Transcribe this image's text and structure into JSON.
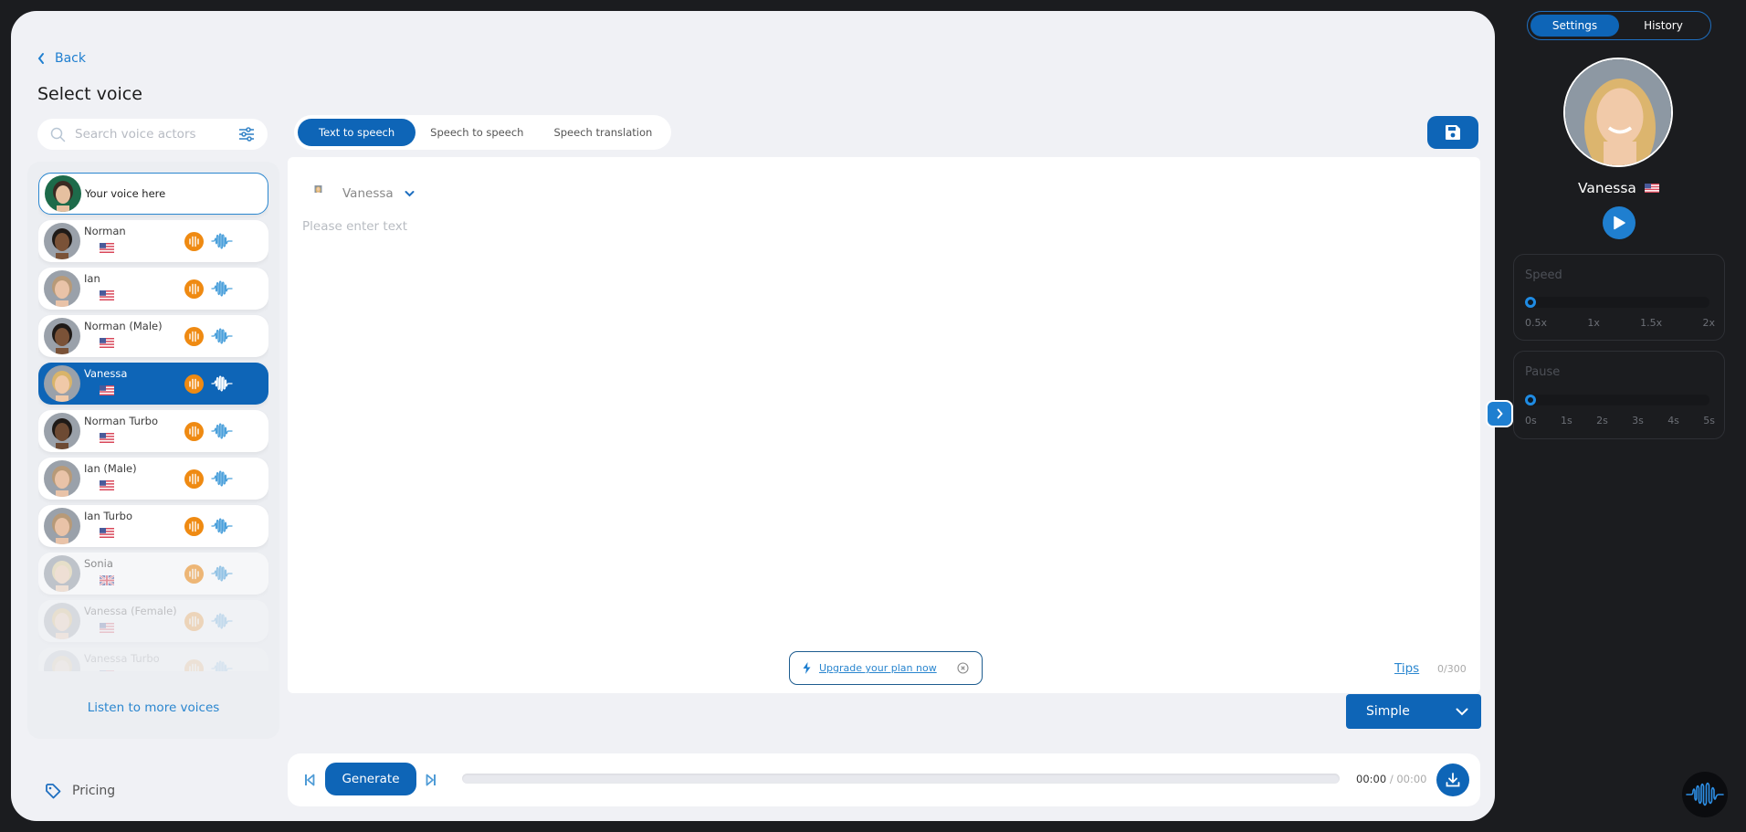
{
  "header": {
    "back_label": "Back",
    "title": "Select voice"
  },
  "search": {
    "placeholder": "Search voice actors",
    "value": ""
  },
  "voices": [
    {
      "name": "Your voice here",
      "flag": "",
      "own": true
    },
    {
      "name": "Norman",
      "flag": "us"
    },
    {
      "name": "Ian",
      "flag": "us"
    },
    {
      "name": "Norman (Male)",
      "flag": "us"
    },
    {
      "name": "Vanessa",
      "flag": "us",
      "selected": true
    },
    {
      "name": "Norman Turbo",
      "flag": "us"
    },
    {
      "name": "Ian (Male)",
      "flag": "us"
    },
    {
      "name": "Ian Turbo",
      "flag": "us"
    },
    {
      "name": "Sonia",
      "flag": "gb"
    },
    {
      "name": "Vanessa (Female)",
      "flag": "us"
    },
    {
      "name": "Vanessa Turbo",
      "flag": "us"
    }
  ],
  "listen_more_label": "Listen to more voices",
  "pricing_label": "Pricing",
  "tabs": [
    {
      "label": "Text to speech",
      "active": true
    },
    {
      "label": "Speech to speech",
      "active": false
    },
    {
      "label": "Speech translation",
      "active": false
    }
  ],
  "editor": {
    "selected_voice": "Vanessa",
    "placeholder": "Please enter text",
    "value": "",
    "upgrade_label": "Upgrade your plan now",
    "tips_label": "Tips",
    "char_count": "0/300"
  },
  "mode": {
    "selected": "Simple"
  },
  "player": {
    "generate_label": "Generate",
    "current_time": "00:00",
    "total_time": "/ 00:00",
    "progress": 0
  },
  "side_panel": {
    "tabs": [
      {
        "label": "Settings",
        "active": true
      },
      {
        "label": "History",
        "active": false
      }
    ],
    "voice_name": "Vanessa",
    "speed": {
      "label": "Speed",
      "ticks": [
        "0.5x",
        "1x",
        "1.5x",
        "2x"
      ],
      "value": "0.5x"
    },
    "pause": {
      "label": "Pause",
      "ticks": [
        "0s",
        "1s",
        "2s",
        "3s",
        "4s",
        "5s"
      ],
      "value": "0s"
    }
  },
  "colors": {
    "primary": "#0e65b7",
    "accent": "#1f7fd0",
    "orange": "#ef8a12",
    "dark_bg": "#1b1c1f",
    "panel_bg": "#f0f1f5"
  }
}
